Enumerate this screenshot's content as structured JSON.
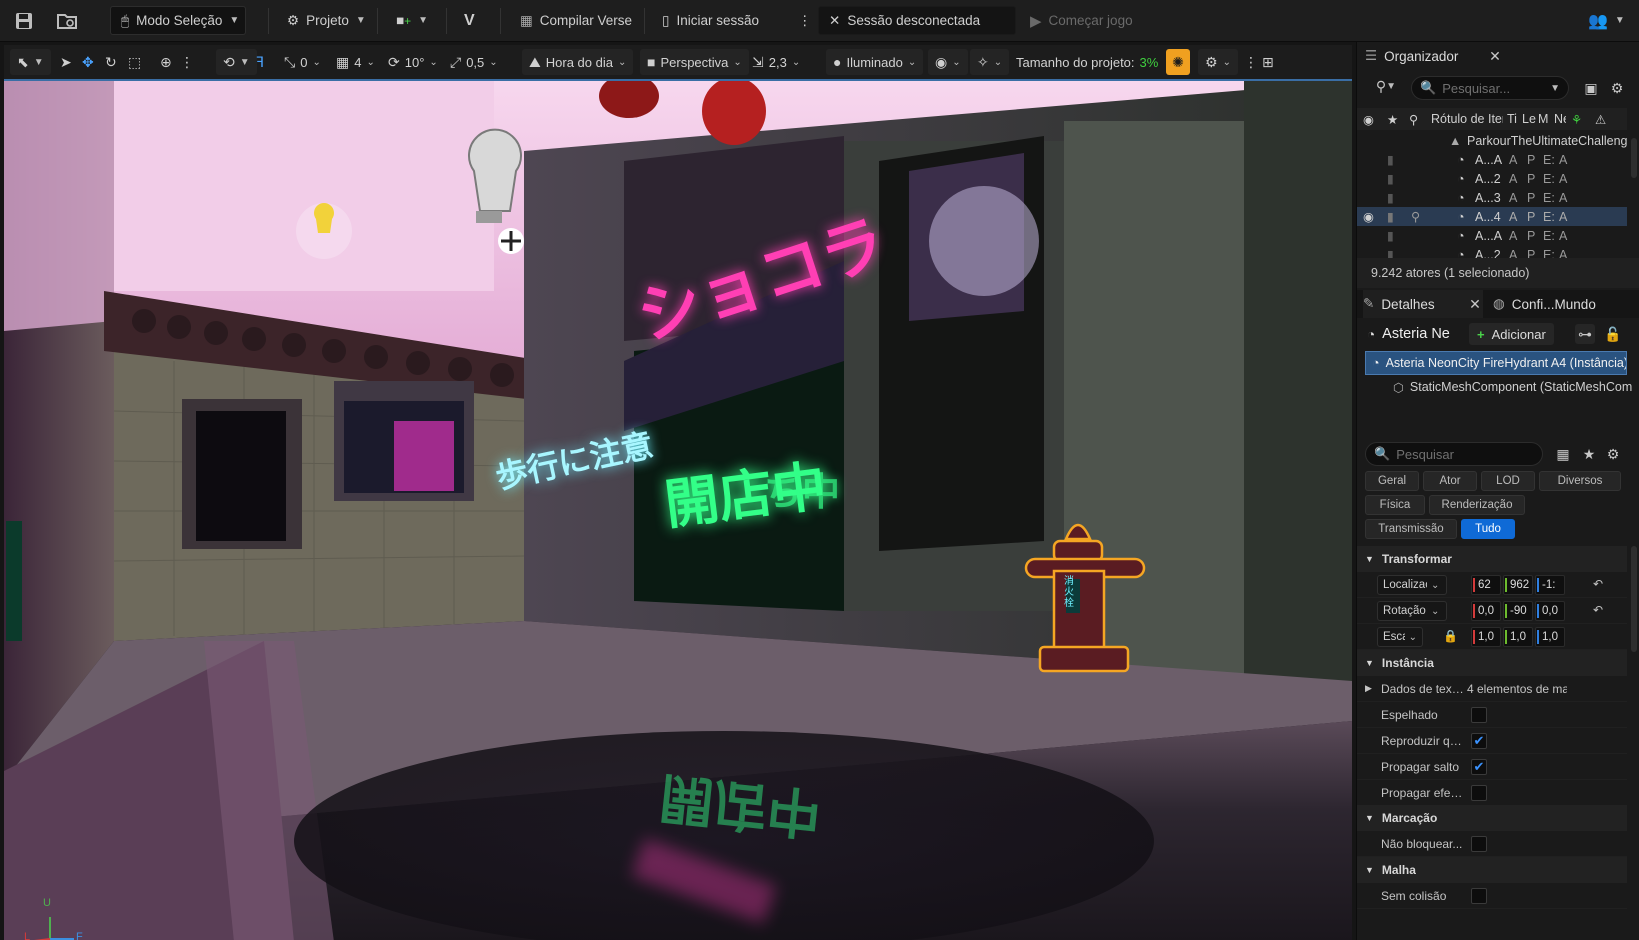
{
  "topbar": {
    "mode": "Modo Seleção",
    "project": "Projeto",
    "compile_verse": "Compilar Verse",
    "start_session": "Iniciar sessão",
    "session_status": "Sessão desconectada",
    "start_game": "Começar jogo"
  },
  "viewport_toolbar": {
    "grid_snap": "0",
    "grid_size": "4",
    "rotation_snap": "10°",
    "scale_snap": "0,5",
    "time_of_day": "Hora do dia",
    "perspective": "Perspectiva",
    "camera_speed": "2,3",
    "lighting": "Iluminado",
    "project_size_label": "Tamanho do projeto:",
    "project_size_value": "3%"
  },
  "viewport": {
    "axis_u": "U",
    "axis_l": "L",
    "axis_f": "F",
    "sign_katakana": "ショコラ",
    "sign_open": "開店中",
    "sign_open_small": "ち中",
    "sign_caution": "歩行に注意",
    "hydrant_sign": "消火栓"
  },
  "outliner": {
    "tab_label": "Organizador",
    "search_placeholder": "Pesquisar...",
    "header_label": "Rótulo de Item",
    "header_cols": [
      "Ti",
      "Le",
      "M",
      "Ne"
    ],
    "root": "ParkourTheUltimateChallenge",
    "rows": [
      {
        "label": "A...A",
        "c1": "A",
        "c2": "P",
        "c3": "E:",
        "c4": "A"
      },
      {
        "label": "A...2",
        "c1": "A",
        "c2": "P",
        "c3": "E:",
        "c4": "A"
      },
      {
        "label": "A...3",
        "c1": "A",
        "c2": "P",
        "c3": "E:",
        "c4": "A"
      },
      {
        "label": "A...4",
        "c1": "A",
        "c2": "P",
        "c3": "E:",
        "c4": "A"
      },
      {
        "label": "A...A",
        "c1": "A",
        "c2": "P",
        "c3": "E:",
        "c4": "A"
      },
      {
        "label": "A...2",
        "c1": "A",
        "c2": "P",
        "c3": "E:",
        "c4": "A"
      }
    ],
    "actor_count": "9.242 atores (1 selecionado)"
  },
  "details": {
    "tab_label": "Detalhes",
    "tab2_label": "Confi...Mundo",
    "actor_name": "Asteria Ne",
    "add_button": "Adicionar",
    "component_root": "Asteria NeonCity FireHydrant A4 (Instância)",
    "component_child": "StaticMeshComponent (StaticMeshComponent0)",
    "search_placeholder": "Pesquisar",
    "categories": [
      "Geral",
      "Ator",
      "LOD",
      "Diversos",
      "Física",
      "Renderização",
      "Transmissão",
      "Tudo"
    ],
    "active_category": "Tudo",
    "sections": {
      "transform": "Transformar",
      "instance": "Instância",
      "tagging": "Marcação",
      "mesh": "Malha"
    },
    "transform": {
      "location_label": "Localização",
      "location": [
        "62",
        "962",
        "-1:"
      ],
      "rotation_label": "Rotação",
      "rotation": [
        "0,0",
        "-90",
        "0,0"
      ],
      "scale_label": "Escala",
      "scale": [
        "1,0",
        "1,0",
        "1,0"
      ]
    },
    "instance_props": {
      "texture_data_label": "Dados de text...",
      "texture_data_value": "4 elementos de ma",
      "mirrored": "Espelhado",
      "play_fall": "Reproduzir qui...",
      "propagate_jump": "Propagar salto",
      "propagate_effect": "Propagar efeit..."
    },
    "tagging_props": {
      "no_block": "Não bloquear..."
    },
    "mesh_props": {
      "no_collision": "Sem colisão"
    }
  },
  "colors": {
    "accent_blue": "#0f6ad6",
    "selection_orange": "#f5a623",
    "neon_pink": "#ff3fb4",
    "neon_green": "#33ff88",
    "neon_cyan": "#6ff0ff"
  }
}
